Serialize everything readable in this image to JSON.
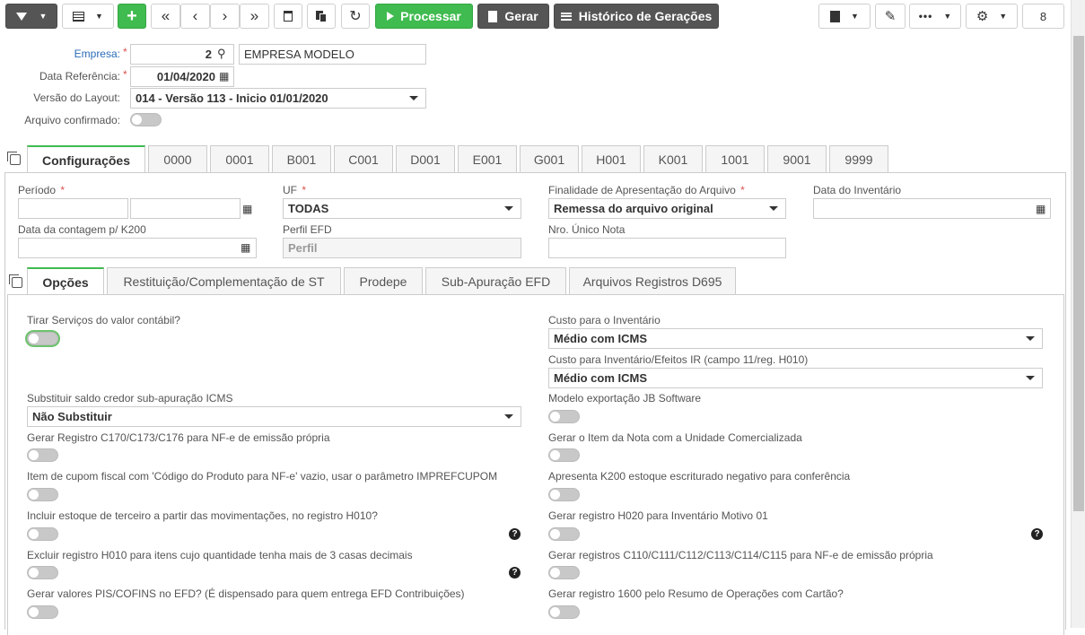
{
  "toolbar": {
    "process_label": "Processar",
    "generate_label": "Gerar",
    "history_label": "Histórico de Gerações",
    "record_count": "8"
  },
  "form": {
    "company_label": "Empresa:",
    "company_code": "2",
    "company_name": "EMPRESA MODELO",
    "ref_date_label": "Data Referência:",
    "ref_date": "01/04/2020",
    "layout_label": "Versão do Layout:",
    "layout_value": "014 - Versão 113 - Inicio 01/01/2020",
    "confirmed_label": "Arquivo confirmado:"
  },
  "main_tabs": [
    "Configurações",
    "0000",
    "0001",
    "B001",
    "C001",
    "D001",
    "E001",
    "G001",
    "H001",
    "K001",
    "1001",
    "9001",
    "9999"
  ],
  "config": {
    "period_label": "Período",
    "uf_label": "UF",
    "uf_value": "TODAS",
    "purpose_label": "Finalidade de Apresentação do Arquivo",
    "purpose_value": "Remessa do arquivo original",
    "inventory_date_label": "Data do Inventário",
    "count_date_label": "Data da contagem p/ K200",
    "profile_label": "Perfil EFD",
    "profile_placeholder": "Perfil",
    "invoice_label": "Nro. Único Nota"
  },
  "sub_tabs": [
    "Opções",
    "Restituição/Complementação de ST",
    "Prodepe",
    "Sub-Apuração EFD",
    "Arquivos Registros D695"
  ],
  "options": {
    "remove_services_label": "Tirar Serviços do valor contábil?",
    "inventory_cost_label": "Custo para o Inventário",
    "inventory_cost_value": "Médio com ICMS",
    "inventory_ir_label": "Custo para Inventário/Efeitos IR (campo 11/reg. H010)",
    "inventory_ir_value": "Médio com ICMS",
    "replace_balance_label": "Substituir saldo credor sub-apuração ICMS",
    "replace_balance_value": "Não Substituir",
    "export_model_label": "Modelo exportação JB Software",
    "c170_label": "Gerar Registro C170/C173/C176 para NF-e de emissão própria",
    "item_unit_label": "Gerar o Item da Nota com a Unidade Comercializada",
    "coupon_label": "Item de cupom fiscal com 'Código do Produto para NF-e' vazio, usar o parâmetro IMPREFCUPOM",
    "k200_negative_label": "Apresenta K200 estoque escriturado negativo para conferência",
    "third_party_label": "Incluir estoque de terceiro a partir das movimentações, no registro H010?",
    "h020_label": "Gerar registro H020 para Inventário Motivo 01",
    "exclude_h010_label": "Excluir registro H010 para itens cujo quantidade tenha mais de 3 casas decimais",
    "c110_label": "Gerar registros C110/C111/C112/C113/C114/C115 para NF-e de emissão própria",
    "pis_cofins_label": "Gerar valores PIS/COFINS no EFD? (É dispensado para quem entrega EFD Contribuições)",
    "r1600_label": "Gerar registro 1600 pelo Resumo de Operações com Cartão?"
  }
}
